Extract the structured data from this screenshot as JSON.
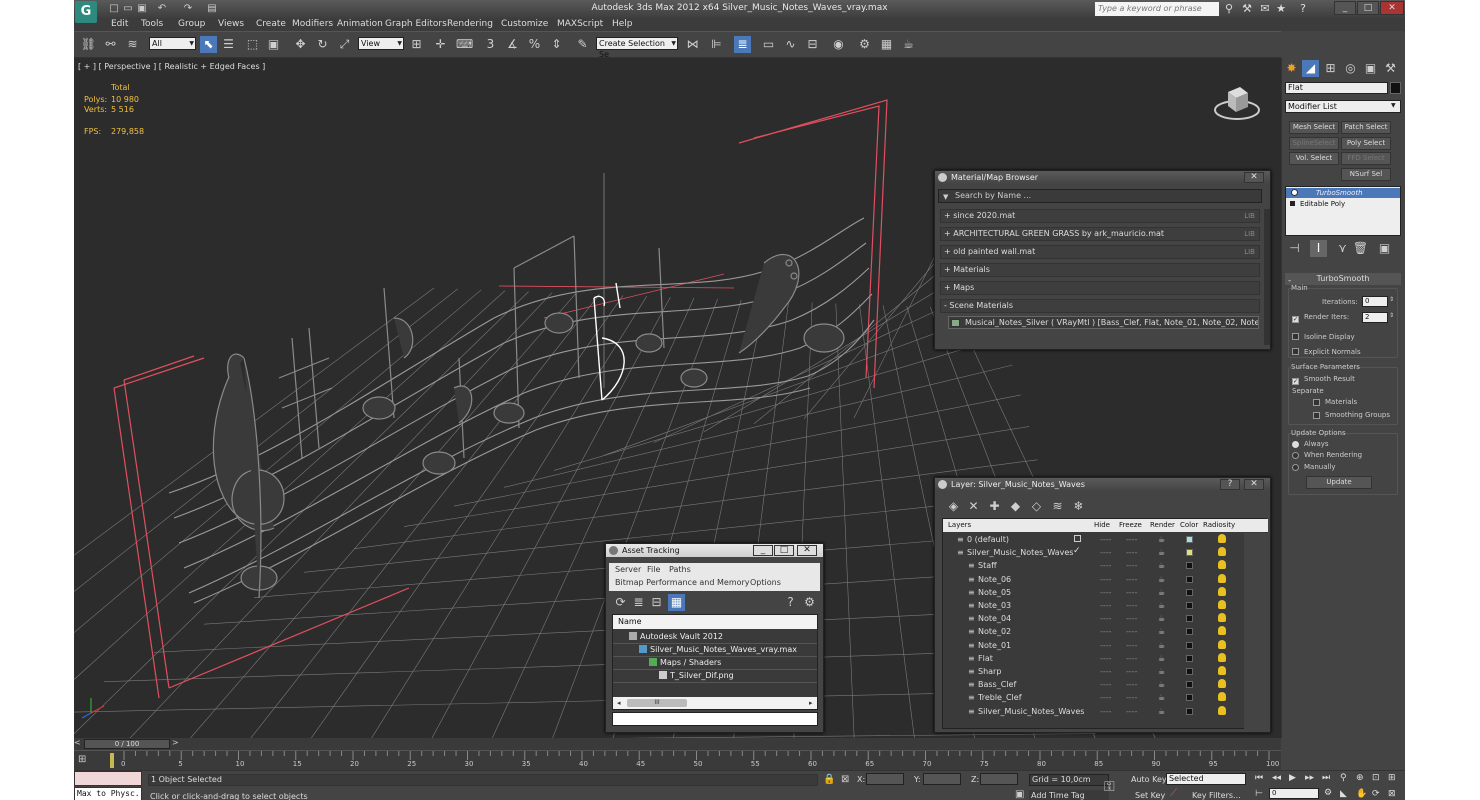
{
  "app": {
    "window_title": "Autodesk 3ds Max  2012 x64     Silver_Music_Notes_Waves_vray.max",
    "search_placeholder": "Type a keyword or phrase"
  },
  "menu": [
    "Edit",
    "Tools",
    "Group",
    "Views",
    "Create",
    "Modifiers",
    "Animation",
    "Graph Editors",
    "Rendering",
    "Customize",
    "MAXScript",
    "Help"
  ],
  "toolbar": {
    "selection_filter": "All",
    "ref_coord": "View",
    "snap_3": "3",
    "selection_set": "Create Selection Se"
  },
  "viewport": {
    "label": "[ + ] [ Perspective ] [ Realistic + Edged Faces ]",
    "stats_header": "Total",
    "polys_label": "Polys:",
    "polys_value": "10 980",
    "verts_label": "Verts:",
    "verts_value": "5 516",
    "fps_label": "FPS:",
    "fps_value": "279,858"
  },
  "command_panel": {
    "object_name": "Flat",
    "modifier_list": "Modifier List",
    "buttons": [
      "Mesh Select",
      "Patch Select",
      "SplineSelect",
      "Poly Select",
      "Vol. Select",
      "FFD Select",
      "NSurf Sel"
    ],
    "stack": [
      "TurboSmooth",
      "Editable Poly"
    ],
    "rollout_title": "TurboSmooth",
    "main_label": "Main",
    "iterations_label": "Iterations:",
    "iterations_value": "0",
    "render_iters_label": "Render Iters:",
    "render_iters_value": "2",
    "isoline_label": "Isoline Display",
    "explicit_label": "Explicit Normals",
    "surface_label": "Surface Parameters",
    "smooth_label": "Smooth Result",
    "separate_label": "Separate",
    "materials_label": "Materials",
    "smoothing_label": "Smoothing Groups",
    "update_label": "Update Options",
    "always_label": "Always",
    "when_render_label": "When Rendering",
    "manually_label": "Manually",
    "update_button": "Update"
  },
  "material_browser": {
    "title": "Material/Map Browser",
    "search": "Search by Name ...",
    "rows": [
      {
        "label": "+ since 2020.mat",
        "tag": "LIB"
      },
      {
        "label": "+ ARCHITECTURAL GREEN GRASS by ark_mauricio.mat",
        "tag": "LIB"
      },
      {
        "label": "+ old painted wall.mat",
        "tag": "LIB"
      },
      {
        "label": "+ Materials",
        "tag": ""
      },
      {
        "label": "+ Maps",
        "tag": ""
      },
      {
        "label": "- Scene Materials",
        "tag": ""
      }
    ],
    "scene_material": "Musical_Notes_Silver  ( VRayMtl )  [Bass_Clef, Flat, Note_01, Note_02, Note_03,..."
  },
  "layer_manager": {
    "title": "Layer: Silver_Music_Notes_Waves",
    "headers": [
      "Layers",
      "Hide",
      "Freeze",
      "Render",
      "Color",
      "Radiosity"
    ],
    "rows": [
      {
        "name": "0 (default)",
        "indent": 0,
        "color": "#a0e0e0"
      },
      {
        "name": "Silver_Music_Notes_Waves",
        "indent": 0,
        "color": "#e0e080"
      },
      {
        "name": "Staff",
        "indent": 1,
        "color": "#111111"
      },
      {
        "name": "Note_06",
        "indent": 1,
        "color": "#111111"
      },
      {
        "name": "Note_05",
        "indent": 1,
        "color": "#111111"
      },
      {
        "name": "Note_03",
        "indent": 1,
        "color": "#111111"
      },
      {
        "name": "Note_04",
        "indent": 1,
        "color": "#111111"
      },
      {
        "name": "Note_02",
        "indent": 1,
        "color": "#111111"
      },
      {
        "name": "Note_01",
        "indent": 1,
        "color": "#111111"
      },
      {
        "name": "Flat",
        "indent": 1,
        "color": "#111111"
      },
      {
        "name": "Sharp",
        "indent": 1,
        "color": "#111111"
      },
      {
        "name": "Bass_Clef",
        "indent": 1,
        "color": "#111111"
      },
      {
        "name": "Treble_Clef",
        "indent": 1,
        "color": "#111111"
      },
      {
        "name": "Silver_Music_Notes_Waves",
        "indent": 1,
        "color": "#111111"
      }
    ],
    "hide_dash": "----"
  },
  "asset_tracking": {
    "title": "Asset Tracking",
    "menu": [
      "Server",
      "File",
      "Paths"
    ],
    "menu2": [
      "Bitmap Performance and Memory",
      "Options"
    ],
    "column": "Name",
    "rows": [
      {
        "name": "Autodesk Vault 2012",
        "indent": 1
      },
      {
        "name": "Silver_Music_Notes_Waves_vray.max",
        "indent": 2
      },
      {
        "name": "Maps / Shaders",
        "indent": 3
      },
      {
        "name": "T_Silver_Dif.png",
        "indent": 4
      }
    ],
    "scroll": "III"
  },
  "timeline": {
    "frame": "0 / 100",
    "ticks": [
      "0",
      "5",
      "10",
      "15",
      "20",
      "25",
      "30",
      "35",
      "40",
      "45",
      "50",
      "55",
      "60",
      "65",
      "70",
      "75",
      "80",
      "85",
      "90",
      "95",
      "100"
    ]
  },
  "status": {
    "script_label": "Max to Physc.",
    "selected": "1 Object Selected",
    "prompt": "Click or click-and-drag to select objects",
    "x_label": "X:",
    "y_label": "Y:",
    "z_label": "Z:",
    "grid": "Grid = 10,0cm",
    "auto_key": "Auto Key",
    "set_key": "Set Key",
    "key_mode": "Selected",
    "key_filters": "Key Filters...",
    "add_time_tag": "Add Time Tag",
    "frame_value": "0"
  },
  "colors": {
    "bg": "#444444",
    "viewport": "#2c2c2c",
    "accent": "#4a78b8",
    "gizmo": "#e05060",
    "stats": "#f0c040"
  }
}
